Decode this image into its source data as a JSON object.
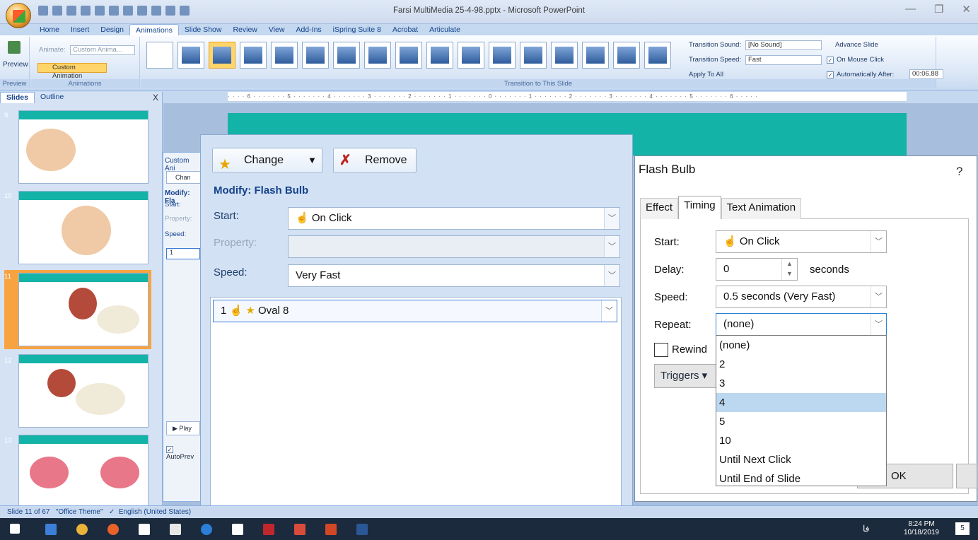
{
  "window": {
    "title": "Farsi MultiMedia 25-4-98.pptx - Microsoft PowerPoint",
    "controls": [
      "—",
      "❐",
      "✕"
    ]
  },
  "ribbon": {
    "tabs": [
      "Home",
      "Insert",
      "Design",
      "Animations",
      "Slide Show",
      "Review",
      "View",
      "Add-Ins",
      "iSpring Suite 8",
      "Acrobat",
      "Articulate"
    ],
    "active_tab": "Animations",
    "preview_label": "Preview",
    "preview_group": "Preview",
    "animate_label": "Animate:",
    "animate_value": "Custom Anima...",
    "custom_animation_label": "Custom Animation",
    "animations_group": "Animations",
    "transition_sound_label": "Transition Sound:",
    "transition_sound_value": "[No Sound]",
    "transition_speed_label": "Transition Speed:",
    "transition_speed_value": "Fast",
    "apply_to_all": "Apply To All",
    "transition_group": "Transition to This Slide",
    "advance_slide": "Advance Slide",
    "on_mouse_click": "On Mouse Click",
    "automatically_after": "Automatically After:",
    "automatically_after_value": "00:06.88",
    "selected_transition_index": 2
  },
  "left_panel": {
    "tabs": [
      "Slides",
      "Outline"
    ],
    "close": "X",
    "slide_numbers": [
      "9",
      "10",
      "11",
      "12",
      "13"
    ],
    "selected_slide": "11"
  },
  "ruler_text": "· · · · 6 · · · · · · · 5 · · · · · · · 4 · · · · · · · 3 · · · · · · · 2 · · · · · · · 1 · · · · · · · 0 · · · · · · · 1 · · · · · · · 2 · · · · · · · 3 · · · · · · · 4 · · · · · · · 5 · · · · · · · 6 · · · · ·",
  "custom_anim_pane": {
    "title": "Custom Ani",
    "change_short": "Chan",
    "modify_short": "Modify: Fla",
    "start_short": "Start:",
    "property_short": "Property:",
    "speed_short": "Speed:",
    "item_short": "1",
    "play_label": "Play",
    "autopreview": "AutoPrev"
  },
  "big_pane": {
    "change_label": "Change",
    "remove_label": "Remove",
    "modify_title": "Modify: Flash Bulb",
    "start_label": "Start:",
    "start_value": "On Click",
    "property_label": "Property:",
    "speed_label": "Speed:",
    "speed_value": "Very Fast",
    "anim_item_number": "1",
    "anim_item_name": "Oval 8"
  },
  "dialog": {
    "title": "Flash Bulb",
    "help": "?",
    "tabs": [
      "Effect",
      "Timing",
      "Text Animation"
    ],
    "active_tab": "Timing",
    "start_label": "Start:",
    "start_value": "On Click",
    "delay_label": "Delay:",
    "delay_value": "0",
    "delay_unit": "seconds",
    "speed_label": "Speed:",
    "speed_value": "0.5 seconds (Very Fast)",
    "repeat_label": "Repeat:",
    "repeat_value": "(none)",
    "rewind_label": "Rewind",
    "triggers_label": "Triggers",
    "repeat_options": [
      "(none)",
      "2",
      "3",
      "4",
      "5",
      "10",
      "Until Next Click",
      "Until End of Slide"
    ],
    "highlighted_option": "4",
    "ok_label": "OK"
  },
  "status": {
    "slide_info": "Slide 11 of 67",
    "theme": "\"Office Theme\"",
    "language": "English (United States)"
  },
  "taskbar": {
    "time": "8:24 PM",
    "date": "10/18/2019",
    "lang": "فا",
    "notifications": "5"
  },
  "colors": {
    "ribbon_blue": "#c4d8ef",
    "slide_teal": "#14b3a7",
    "highlight": "#bcd8f0",
    "selected_thumb": "#f7a341"
  }
}
